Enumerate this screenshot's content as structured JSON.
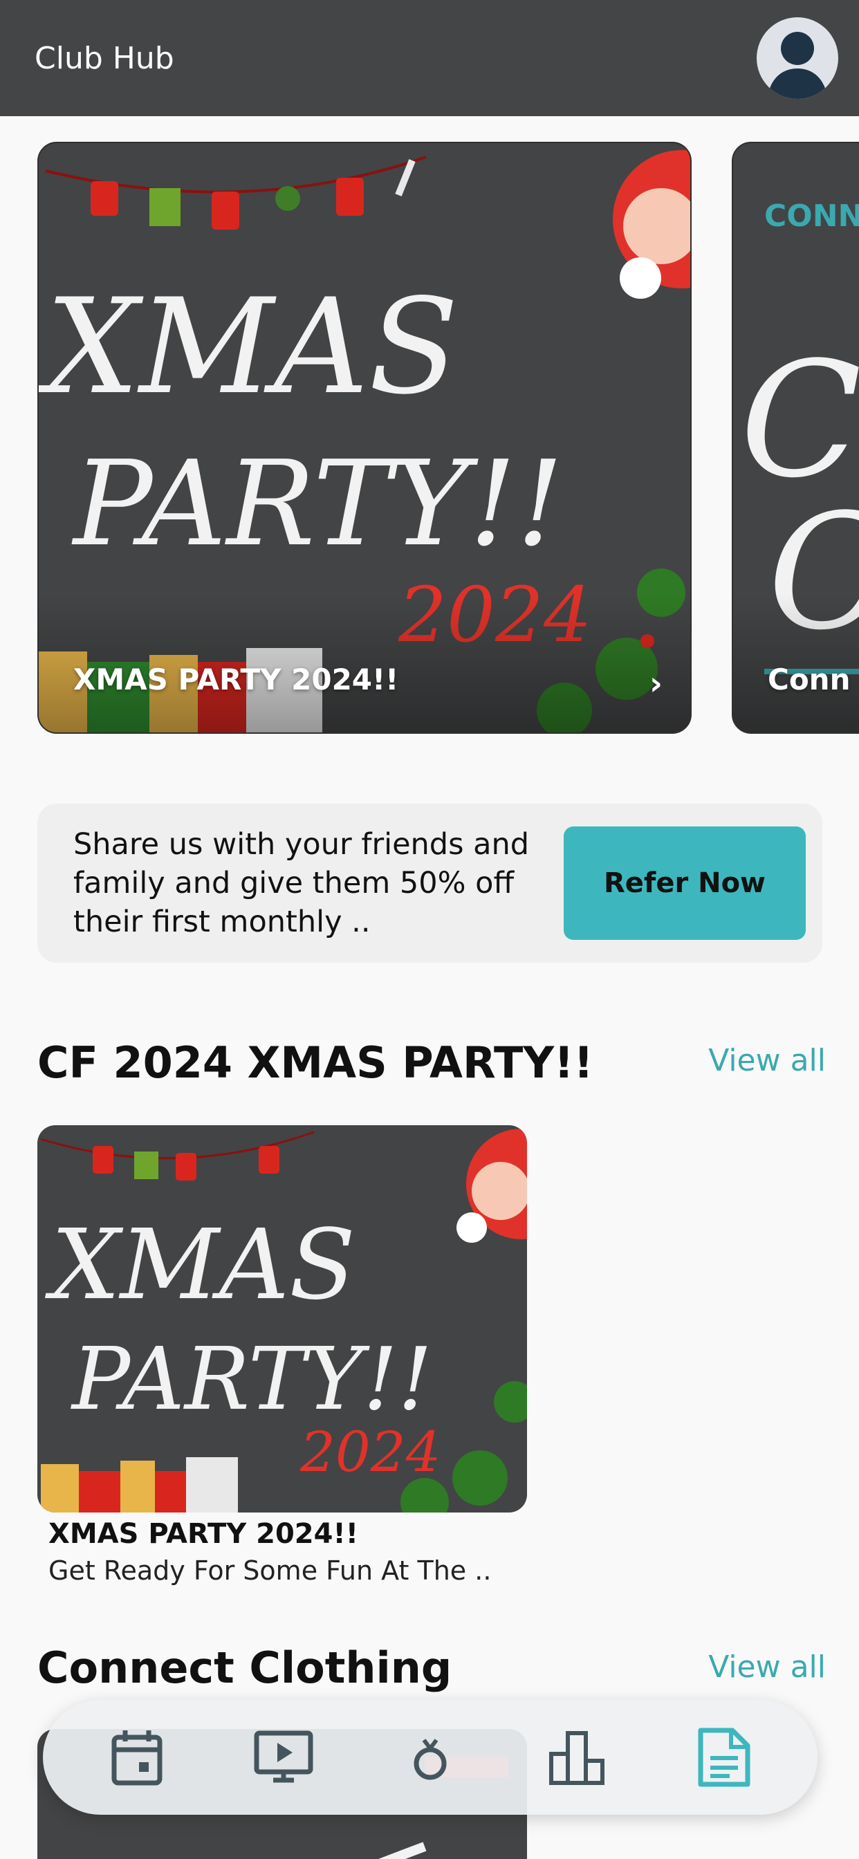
{
  "header": {
    "title": "Club Hub",
    "avatar_icon": "user-avatar-icon"
  },
  "carousel": {
    "cards": [
      {
        "caption": "XMAS PARTY 2024!!",
        "art_line1": "XMAS",
        "art_line2": "PARTY!!",
        "art_year": "2024"
      },
      {
        "caption": "Conn",
        "art_top": "CONNE",
        "art_big": "C"
      }
    ]
  },
  "referral": {
    "text": "Share us with your friends and family and give them 50% off their first monthly ..",
    "button_label": "Refer Now"
  },
  "section_events": {
    "title": "CF 2024 XMAS PARTY!!",
    "view_all": "View all",
    "item": {
      "title": "XMAS PARTY 2024!!",
      "subtitle": "Get Ready For Some Fun At The ..",
      "art_line1": "XMAS",
      "art_line2": "PARTY!!",
      "art_year": "2024"
    }
  },
  "section_clothing": {
    "title": "Connect Clothing",
    "view_all": "View all"
  },
  "bottom_nav": {
    "items": [
      {
        "icon": "calendar-icon",
        "active": false
      },
      {
        "icon": "video-play-icon",
        "active": false
      },
      {
        "icon": "ring-icon",
        "active": false
      },
      {
        "icon": "leaderboard-icon",
        "active": false
      },
      {
        "icon": "document-icon",
        "active": true
      }
    ]
  },
  "colors": {
    "header_bg": "#444546",
    "accent": "#3db7bd",
    "card_bg": "#434445",
    "santa_red": "#e0322a"
  }
}
